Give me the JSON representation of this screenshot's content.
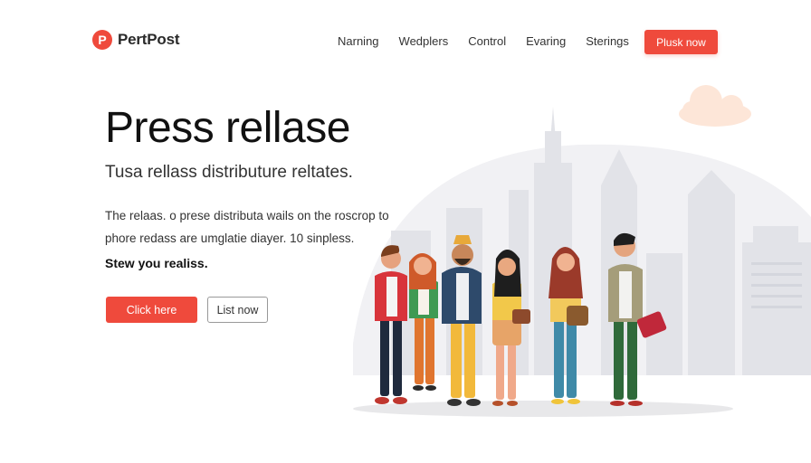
{
  "brand": {
    "logo_letter": "P",
    "name": "PertPost",
    "color": "#ef4a3c"
  },
  "nav": {
    "items": [
      "Narning",
      "Wedplers",
      "Control",
      "Evaring",
      "Sterings"
    ],
    "cta_label": "Plusk now"
  },
  "hero": {
    "title": "Press rellase",
    "subtitle": "Tusa rellass distributure reltates.",
    "description_line1": "The relaas. o prese distributa wails on the roscrop to",
    "description_line2": "phore redass are umglatie diayer. 10 sinpless.",
    "cta_text": "Stew you realiss.",
    "primary_button": "Click here",
    "secondary_button": "List now"
  },
  "illustration": {
    "subject": "group-of-people-city-skyline",
    "colors": {
      "accent": "#ef4a3c",
      "skyline": "#e4e5ea",
      "cloud": "#fde6d8"
    }
  }
}
